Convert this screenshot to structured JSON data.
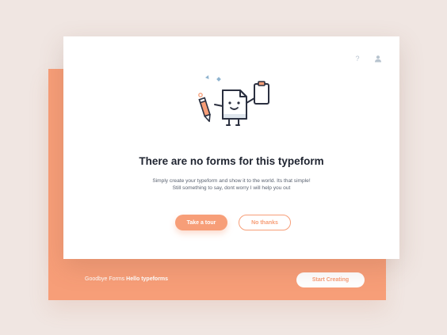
{
  "empty_state": {
    "title": "There are no forms for this typeform",
    "subtitle_line1": "Simply create your typeform and show it to the world. Its that simple!",
    "subtitle_line2": "Still something to say, dont worry I will help you out",
    "primary_button": "Take a tour",
    "secondary_button": "No thanks"
  },
  "header_icons": {
    "help": "?",
    "help_icon": "question-mark-icon",
    "user_icon": "user-icon"
  },
  "footer": {
    "text_regular": "Goodbye Forms",
    "text_bold": "Hello typeforms",
    "cta_label": "Start Creating"
  },
  "colors": {
    "accent": "#f79e78",
    "background": "#f0e6e2",
    "title": "#1f2430",
    "body_text": "#5a6270",
    "icon_muted": "#b8c4cf"
  }
}
